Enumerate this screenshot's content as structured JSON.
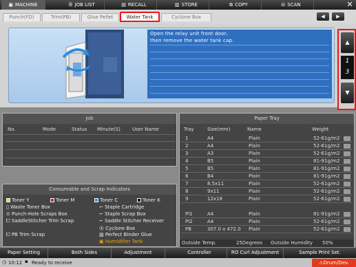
{
  "topbar": {
    "tabs": [
      {
        "label": "MACHINE",
        "active": true
      },
      {
        "label": "JOB LIST"
      },
      {
        "label": "RECALL"
      },
      {
        "label": "STORE"
      },
      {
        "label": "COPY"
      },
      {
        "label": "SCAN"
      }
    ]
  },
  "subtabs": {
    "items": [
      "Punch(FD)",
      "Trim(PB)",
      "Glue Pellet",
      "Water Tank",
      "Cyclone Box"
    ],
    "selected": "Water Tank"
  },
  "guide": {
    "line1": "Open the relay unit front door,",
    "line2": "then remove the water tank cap."
  },
  "pager": {
    "current": "1",
    "total": "3"
  },
  "job": {
    "title": "Job",
    "cols": [
      "No.",
      "Mode",
      "Status",
      "Minute(S)",
      "User Name"
    ]
  },
  "consumables": {
    "title": "Consumable and Scrap Indicators",
    "toner": [
      "Toner Y",
      "Toner M",
      "Toner C",
      "Toner K"
    ],
    "left": [
      "Waste Toner Box",
      "Punch-Hole Scraps Box",
      "SaddleStitcher Trim Scrap",
      "PB Trim Scrap"
    ],
    "right": [
      "Staple Cartridge",
      "Staple Scrap Box",
      "Saddle Stitcher Receiver",
      "Cyclone Box",
      "Perfect Binder Glue",
      "Humidifier Tank"
    ]
  },
  "tray": {
    "title": "Paper Tray",
    "cols": [
      "Tray",
      "Size(mm)",
      "Name",
      "Weight"
    ],
    "rows": [
      [
        "1",
        "A4",
        "Plain",
        "52-61g/m2"
      ],
      [
        "2",
        "A4",
        "Plain",
        "52-61g/m2"
      ],
      [
        "3",
        "A3",
        "Plain",
        "52-61g/m2"
      ],
      [
        "4",
        "B5",
        "Plain",
        "81-91g/m2"
      ],
      [
        "5",
        "B5",
        "Plain",
        "81-91g/m2"
      ],
      [
        "6",
        "B4",
        "Plain",
        "81-91g/m2"
      ],
      [
        "7",
        "8.5x11",
        "Plain",
        "52-61g/m2"
      ],
      [
        "8",
        "9x11",
        "Plain",
        "52-61g/m2"
      ],
      [
        "9",
        "12x18",
        "Plain",
        "52-61g/m2"
      ],
      [
        "PI1",
        "A4",
        "Plain",
        "81-91g/m2"
      ],
      [
        "PI2",
        "A4",
        "Plain",
        "52-61g/m2"
      ],
      [
        "PB",
        "307.0 x 472.0",
        "Plain",
        "52-61g/m2"
      ]
    ],
    "outside_temp_label": "Outside Temp.",
    "outside_temp": "25Degrees",
    "humidity_label": "Outside Humidity",
    "humidity": "50%"
  },
  "bottom": [
    "Paper Setting",
    "Both Sides",
    "Adjustment",
    "Controller",
    "RO Curl Adjustment",
    "Sample Print Set."
  ],
  "status": {
    "time": "10:12",
    "text": "Ready to receive",
    "error": "Drum/Dev."
  }
}
